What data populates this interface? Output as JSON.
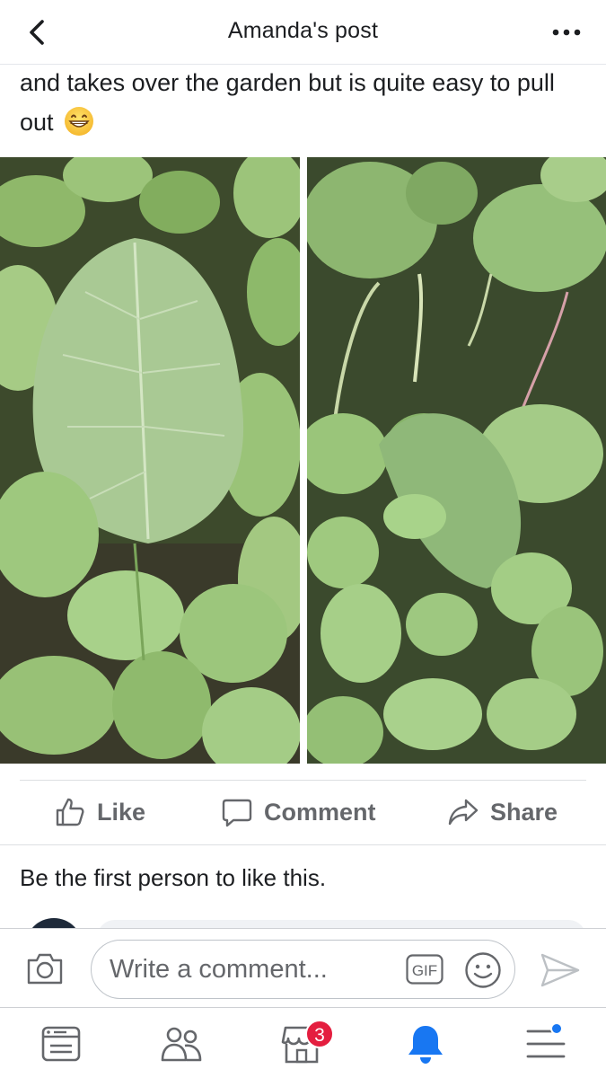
{
  "header": {
    "title": "Amanda's post",
    "back_icon": "chevron-left-icon",
    "more_icon": "more-dots-icon"
  },
  "post": {
    "text": "and takes over the garden but is quite easy to pull out",
    "emoji": "grinning-face-icon",
    "photos": [
      {
        "subject": "leafy-weeds-photo-left"
      },
      {
        "subject": "leafy-weeds-photo-right"
      }
    ]
  },
  "actions": {
    "like": "Like",
    "comment": "Comment",
    "share": "Share"
  },
  "reactions_summary": "Be the first person to like this.",
  "composer": {
    "placeholder": "Write a comment...",
    "gif_label": "GIF"
  },
  "bottom_nav": {
    "marketplace_badge": "3",
    "active_item": "notifications",
    "active_color": "#1877f2"
  },
  "colors": {
    "accent": "#1877f2",
    "badge": "#e41e3f",
    "secondary_text": "#65676b"
  }
}
